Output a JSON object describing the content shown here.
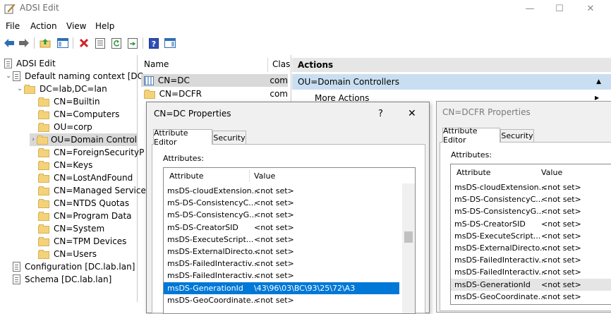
{
  "window": {
    "title": "ADSI Edit",
    "minimize": "—",
    "maximize": "☐",
    "close": "✕"
  },
  "menu": [
    "File",
    "Action",
    "View",
    "Help"
  ],
  "toolbar_icons": [
    "back-arrow-icon",
    "forward-arrow-icon",
    "up-folder-icon",
    "show-hide-tree-icon",
    "delete-icon",
    "properties-icon",
    "refresh-icon",
    "export-list-icon",
    "help-icon",
    "show-hide-action-pane-icon"
  ],
  "tree": {
    "root": "ADSI Edit",
    "items": [
      {
        "label": "Default naming context [DC.",
        "twisty": "⌄"
      },
      {
        "label": "DC=lab,DC=lan",
        "twisty": "⌄"
      },
      {
        "label": "CN=Builtin"
      },
      {
        "label": "CN=Computers"
      },
      {
        "label": "OU=corp"
      },
      {
        "label": "OU=Domain Control",
        "twisty": "›"
      },
      {
        "label": "CN=ForeignSecurityP"
      },
      {
        "label": "CN=Keys"
      },
      {
        "label": "CN=LostAndFound"
      },
      {
        "label": "CN=Managed Service"
      },
      {
        "label": "CN=NTDS Quotas"
      },
      {
        "label": "CN=Program Data"
      },
      {
        "label": "CN=System"
      },
      {
        "label": "CN=TPM Devices"
      },
      {
        "label": "CN=Users"
      },
      {
        "label": "Configuration [DC.lab.lan]"
      },
      {
        "label": "Schema [DC.lab.lan]"
      }
    ]
  },
  "list": {
    "headers": [
      "Name",
      "Clas"
    ],
    "rows": [
      {
        "name": "CN=DC",
        "class": "com"
      },
      {
        "name": "CN=DCFR",
        "class": "com"
      }
    ]
  },
  "actions": {
    "header": "Actions",
    "section": "OU=Domain Controllers",
    "section_arrow": "▲",
    "more": "More Actions",
    "more_arrow": "▶"
  },
  "dialog_dc": {
    "title": "CN=DC Properties",
    "help": "?",
    "close": "✕",
    "tabs": [
      "Attribute Editor",
      "Security"
    ],
    "attributes_label": "Attributes:",
    "columns": [
      "Attribute",
      "Value"
    ],
    "rows": [
      {
        "attr": "msDS-cloudExtension...",
        "value": "<not set>"
      },
      {
        "attr": "mS-DS-ConsistencyC...",
        "value": "<not set>"
      },
      {
        "attr": "mS-DS-ConsistencyG...",
        "value": "<not set>"
      },
      {
        "attr": "mS-DS-CreatorSID",
        "value": "<not set>"
      },
      {
        "attr": "msDS-ExecuteScript...",
        "value": "<not set>"
      },
      {
        "attr": "msDS-ExternalDirecto...",
        "value": "<not set>"
      },
      {
        "attr": "msDS-FailedInteractiv...",
        "value": "<not set>"
      },
      {
        "attr": "msDS-FailedInteractiv...",
        "value": "<not set>"
      },
      {
        "attr": "msDS-GenerationId",
        "value": "\\43\\96\\03\\BC\\93\\25\\72\\A3"
      },
      {
        "attr": "msDS-GeoCoordinate...",
        "value": "<not set>"
      }
    ]
  },
  "dialog_dcfr": {
    "title": "CN=DCFR Properties",
    "tabs": [
      "Attribute Editor",
      "Security"
    ],
    "attributes_label": "Attributes:",
    "columns": [
      "Attribute",
      "Value"
    ],
    "rows": [
      {
        "attr": "msDS-cloudExtension...",
        "value": "<not set>"
      },
      {
        "attr": "mS-DS-ConsistencyC...",
        "value": "<not set>"
      },
      {
        "attr": "mS-DS-ConsistencyG...",
        "value": "<not set>"
      },
      {
        "attr": "mS-DS-CreatorSID",
        "value": "<not set>"
      },
      {
        "attr": "msDS-ExecuteScript...",
        "value": "<not set>"
      },
      {
        "attr": "msDS-ExternalDirecto...",
        "value": "<not set>"
      },
      {
        "attr": "msDS-FailedInteractiv...",
        "value": "<not set>"
      },
      {
        "attr": "msDS-FailedInteractiv...",
        "value": "<not set>"
      },
      {
        "attr": "msDS-GenerationId",
        "value": "<not set>"
      },
      {
        "attr": "msDS-GeoCoordinate...",
        "value": "<not set>"
      }
    ]
  },
  "colors": {
    "selection": "#0078d7",
    "actions_section": "#c9dff1",
    "selected_gray": "#d9d9d9"
  }
}
